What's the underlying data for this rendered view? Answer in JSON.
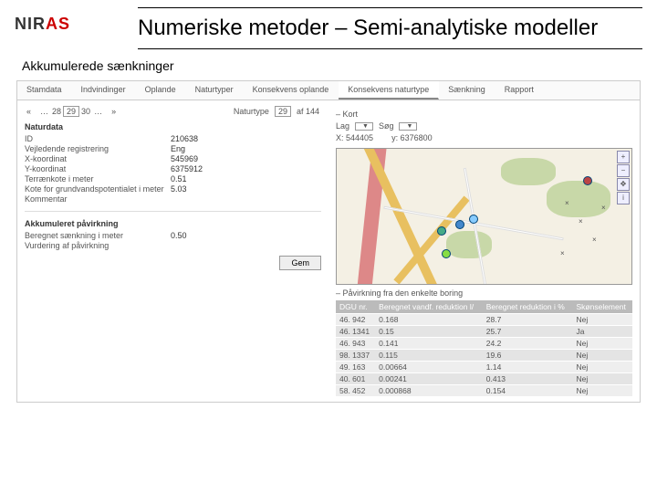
{
  "brand": {
    "name_a": "NIR",
    "name_b": "AS"
  },
  "title": "Numeriske metoder – Semi-analytiske modeller",
  "subtitle": "Akkumulerede sænkninger",
  "tabs": [
    "Stamdata",
    "Indvindinger",
    "Oplande",
    "Naturtyper",
    "Konsekvens oplande",
    "Konsekvens naturtype",
    "Sænkning",
    "Rapport"
  ],
  "active_tab": 5,
  "pager": {
    "prev": "«",
    "pages": [
      "…",
      "28",
      "29",
      "30",
      "…"
    ],
    "next": "»",
    "label": "Naturtype",
    "current": "29",
    "total": "af 144"
  },
  "naturdata": {
    "title": "Naturdata",
    "rows": [
      {
        "k": "ID",
        "v": "210638"
      },
      {
        "k": "Vejledende registrering",
        "v": "Eng"
      },
      {
        "k": "X-koordinat",
        "v": "545969"
      },
      {
        "k": "Y-koordinat",
        "v": "6375912"
      },
      {
        "k": "Terrænkote i meter",
        "v": "0.51"
      },
      {
        "k": "Kote for grundvandspotentialet i meter",
        "v": "5.03"
      },
      {
        "k": "Kommentar",
        "v": ""
      }
    ]
  },
  "akk": {
    "title": "Akkumuleret påvirkning",
    "rows": [
      {
        "k": "Beregnet sænkning i meter",
        "v": "0.50"
      },
      {
        "k": "Vurdering af påvirkning",
        "v": ""
      }
    ]
  },
  "gem": "Gem",
  "kort": {
    "section": "– Kort",
    "lag_label": "Lag",
    "lag": "",
    "sog_label": "Søg",
    "sog": "",
    "x": "544405",
    "y": "6376800"
  },
  "ptitle": "– Påvirkning fra den enkelte boring",
  "table": {
    "headers": [
      "DGU nr.",
      "Beregnet vandf. reduktion l/",
      "Beregnet reduktion i %",
      "Skønselement"
    ],
    "rows": [
      [
        "46. 942",
        "0.168",
        "28.7",
        "Nej"
      ],
      [
        "46. 1341",
        "0.15",
        "25.7",
        "Ja"
      ],
      [
        "46. 943",
        "0.141",
        "24.2",
        "Nej"
      ],
      [
        "98. 1337",
        "0.115",
        "19.6",
        "Nej"
      ],
      [
        "49. 163",
        "0.00664",
        "1.14",
        "Nej"
      ],
      [
        "40. 601",
        "0.00241",
        "0.413",
        "Nej"
      ],
      [
        "58. 452",
        "0.000868",
        "0.154",
        "Nej"
      ]
    ]
  }
}
